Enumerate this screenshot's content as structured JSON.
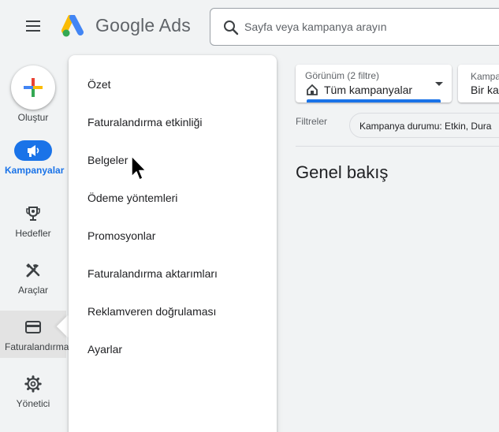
{
  "header": {
    "brand": "Google Ads",
    "search_placeholder": "Sayfa veya kampanya arayın"
  },
  "rail": {
    "create_label": "Oluştur",
    "items": [
      {
        "label": "Kampanyalar",
        "icon": "megaphone-icon"
      },
      {
        "label": "Hedefler",
        "icon": "trophy-icon"
      },
      {
        "label": "Araçlar",
        "icon": "tools-icon"
      },
      {
        "label": "Faturalandırma",
        "icon": "credit-card-icon"
      },
      {
        "label": "Yönetici",
        "icon": "gear-icon"
      }
    ]
  },
  "billing_menu": {
    "items": [
      {
        "label": "Özet"
      },
      {
        "label": "Faturalandırma etkinliği"
      },
      {
        "label": "Belgeler"
      },
      {
        "label": "Ödeme yöntemleri"
      },
      {
        "label": "Promosyonlar"
      },
      {
        "label": "Faturalandırma aktarımları"
      },
      {
        "label": "Reklamveren doğrulaması"
      },
      {
        "label": "Ayarlar"
      }
    ]
  },
  "main": {
    "view_selector": {
      "caption": "Görünüm (2 filtre)",
      "value": "Tüm kampanyalar"
    },
    "campaign_selector": {
      "caption": "Kampa",
      "value": "Bir ka"
    },
    "filters_label": "Filtreler",
    "filter_chip": "Kampanya durumu: Etkin, Dura",
    "title": "Genel bakış"
  },
  "colors": {
    "accent": "#1a73e8",
    "background": "#f1f3f4",
    "google_blue": "#4285f4",
    "google_red": "#ea4335",
    "google_yellow": "#fbbc04",
    "google_green": "#34a853"
  }
}
